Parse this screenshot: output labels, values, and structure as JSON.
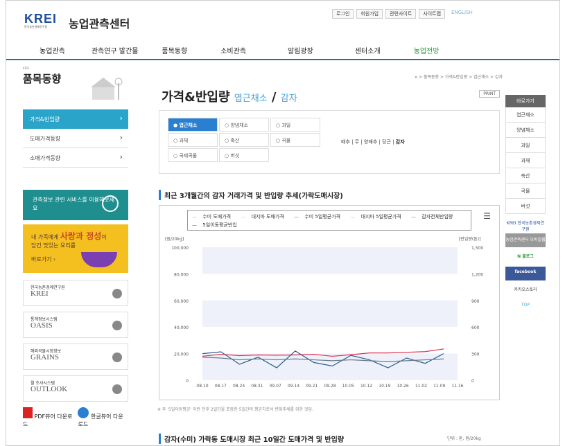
{
  "header": {
    "logo_text": "KREI",
    "logo_sub": "한국농촌경제연구원",
    "site_name": "농업관측센터",
    "top_links": [
      "로그인",
      "회원가입",
      "관련사이트",
      "사이트맵",
      "ENGLISH"
    ],
    "nav": [
      "농업관측",
      "관측연구 발간물",
      "품목동향",
      "소비관측",
      "알림광장",
      "센터소개",
      "농업전망"
    ]
  },
  "sidebar": {
    "tag": "KREI",
    "title": "품목동향",
    "menu": [
      "가격&반입량",
      "도매가격동향",
      "소매가격동향"
    ],
    "banner1": "관측정보 관련 서비스를 이용해보세요",
    "banner2_a": "내 가족에게",
    "banner2_b": "사랑과 정성",
    "banner2_c": "이",
    "banner2_d": "담긴 맛있는 요리를",
    "banner2_e": "바로가기",
    "links": [
      {
        "small": "한국농촌경제연구원",
        "big": "KREI"
      },
      {
        "small": "통계정보시스템",
        "big": "OASIS"
      },
      {
        "small": "해외곡물시장정보",
        "big": "GRAINS"
      },
      {
        "small": "월 조사시스템",
        "big": "OUTLOOK"
      }
    ],
    "pdf": "PDF뷰어 다운로드",
    "hwp": "한글뷰어 다운로드"
  },
  "content": {
    "breadcrumb": "⌂ > 품목동향 > 가격&반입량 > 엽근채소 > 감자",
    "title": "가격&반입량",
    "title_sub1": "엽근채소",
    "title_sub2": "감자",
    "print": "PRINT",
    "chips": [
      "엽근채소",
      "양념채소",
      "과일",
      "과채",
      "축산",
      "곡물",
      "국제곡물",
      "버섯"
    ],
    "subcats": "배추 | 무 | 양배추 | 당근 |",
    "subcat_on": "감자",
    "chart_title": "최근 3개월간의 감자 거래가격 및 반입량 추세(가락도매시장)",
    "note": "※ 주 '5일이동평균' 이란 전후 2일간을 포함한 5일간의 평균치로서 변화추세를 위한 것임.",
    "section2": "감자(수미) 가락동 도매시장 최근 10일간 도매가격 및 반입량",
    "unit2": "단위 : 톤, 원/20kg"
  },
  "quick": {
    "header": "바로가기",
    "items": [
      "엽근채소",
      "양념채소",
      "과일",
      "과채",
      "축산",
      "곡물",
      "버섯"
    ],
    "krei": "KREI 한국농촌경제연구원",
    "center": "농업관측센터 모바일웹",
    "blog": "N 블로그",
    "facebook": "facebook",
    "kakao": "카카오스토리",
    "top": "TOP"
  },
  "chart_data": {
    "type": "line",
    "legend": [
      "수미 도매가격",
      "대지마 도매가격",
      "수미 5일평균가격",
      "대지마 5일평균가격",
      "감자전체반입량",
      "5일이동평균반입"
    ],
    "ylabel_left": "[원/20kg]",
    "ylabel_right": "[반입량(톤)]",
    "yticks_left": [
      "100,000",
      "80,000",
      "60,000",
      "40,000",
      "20,000",
      "0"
    ],
    "yticks_right": [
      "1,500",
      "1,200",
      "900",
      "600",
      "300",
      "0"
    ],
    "x": [
      "08.10",
      "08.17",
      "08.24",
      "08.31",
      "09.07",
      "09.14",
      "09.21",
      "09.28",
      "10.05",
      "10.12",
      "10.19",
      "10.26",
      "11.02",
      "11.09",
      "11.16"
    ],
    "ylim_left": [
      0,
      100000
    ],
    "ylim_right": [
      0,
      1500
    ],
    "series": [
      {
        "name": "수미 5일평균가격",
        "color": "#e03050",
        "values": [
          18000,
          19500,
          18500,
          19000,
          18800,
          19000,
          19500,
          18000,
          19200,
          20500,
          20500,
          21000,
          21500,
          23500
        ]
      },
      {
        "name": "감자전체반입량",
        "color": "#2a5f8a",
        "values": [
          300,
          320,
          180,
          260,
          140,
          330,
          200,
          160,
          280,
          230,
          140,
          250,
          190,
          300
        ]
      },
      {
        "name": "5일이동평균반입",
        "color": "#6a7a8a",
        "values": [
          260,
          250,
          230,
          240,
          230,
          240,
          230,
          220,
          230,
          220,
          210,
          220,
          230,
          240
        ]
      }
    ]
  }
}
